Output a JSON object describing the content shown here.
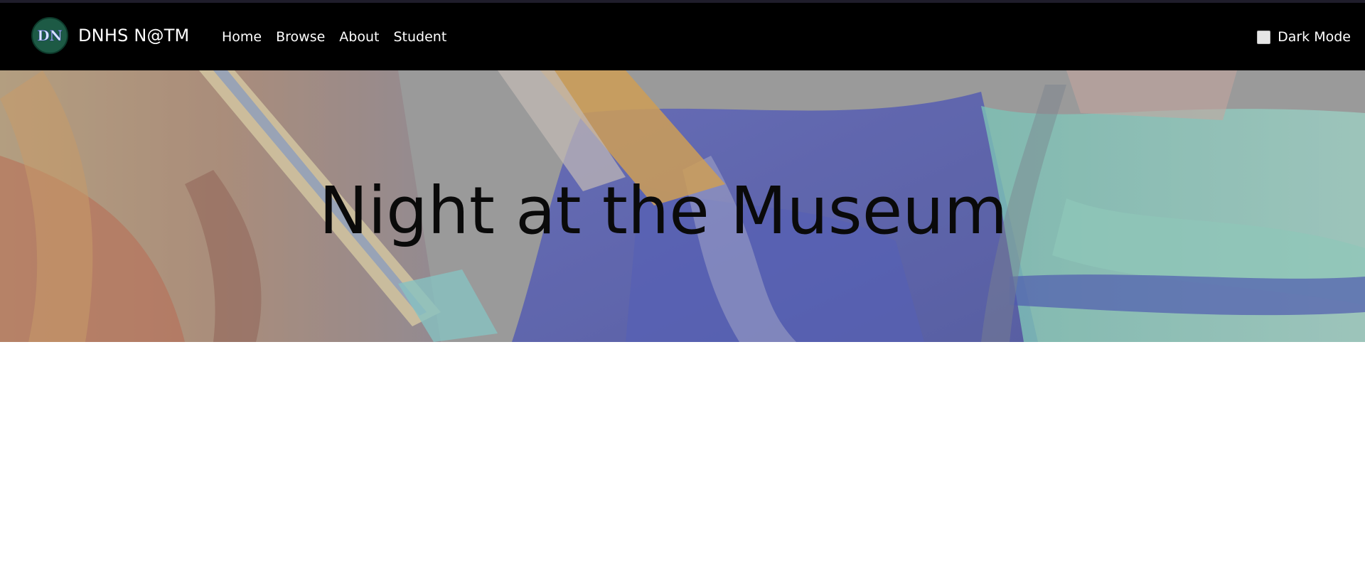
{
  "brand": {
    "name": "DNHS N@TM",
    "logo_letters": "DN",
    "logo_color": "#1d5a45"
  },
  "nav": {
    "items": [
      {
        "label": "Home"
      },
      {
        "label": "Browse"
      },
      {
        "label": "About"
      },
      {
        "label": "Student"
      }
    ]
  },
  "settings": {
    "dark_mode_label": "Dark Mode",
    "dark_mode_checked": false
  },
  "hero": {
    "title": "Night at the Museum",
    "background": "paint-brushes-image"
  },
  "colors": {
    "navbar_bg": "#000000",
    "page_bg": "#ffffff",
    "hero_overlay": "#8e8e8e"
  }
}
